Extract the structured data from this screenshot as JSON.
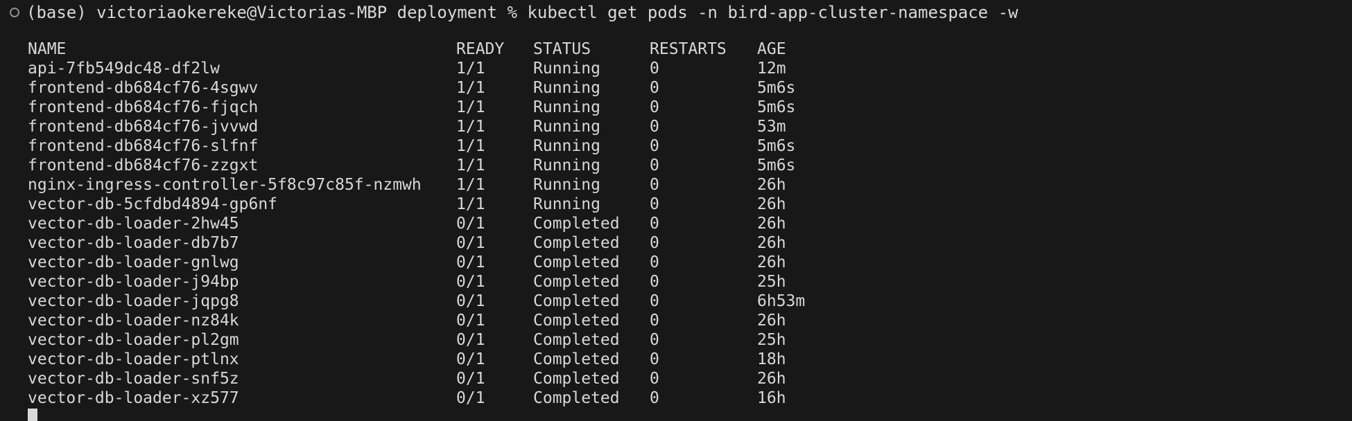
{
  "prompt": {
    "text": "(base) victoriaokereke@Victorias-MBP deployment % ",
    "command": "kubectl get pods -n bird-app-cluster-namespace -w"
  },
  "table": {
    "headers": [
      "NAME",
      "READY",
      "STATUS",
      "RESTARTS",
      "AGE"
    ],
    "rows": [
      [
        "api-7fb549dc48-df2lw",
        "1/1",
        "Running",
        "0",
        "12m"
      ],
      [
        "frontend-db684cf76-4sgwv",
        "1/1",
        "Running",
        "0",
        "5m6s"
      ],
      [
        "frontend-db684cf76-fjqch",
        "1/1",
        "Running",
        "0",
        "5m6s"
      ],
      [
        "frontend-db684cf76-jvvwd",
        "1/1",
        "Running",
        "0",
        "53m"
      ],
      [
        "frontend-db684cf76-slfnf",
        "1/1",
        "Running",
        "0",
        "5m6s"
      ],
      [
        "frontend-db684cf76-zzgxt",
        "1/1",
        "Running",
        "0",
        "5m6s"
      ],
      [
        "nginx-ingress-controller-5f8c97c85f-nzmwh",
        "1/1",
        "Running",
        "0",
        "26h"
      ],
      [
        "vector-db-5cfdbd4894-gp6nf",
        "1/1",
        "Running",
        "0",
        "26h"
      ],
      [
        "vector-db-loader-2hw45",
        "0/1",
        "Completed",
        "0",
        "26h"
      ],
      [
        "vector-db-loader-db7b7",
        "0/1",
        "Completed",
        "0",
        "26h"
      ],
      [
        "vector-db-loader-gnlwg",
        "0/1",
        "Completed",
        "0",
        "26h"
      ],
      [
        "vector-db-loader-j94bp",
        "0/1",
        "Completed",
        "0",
        "25h"
      ],
      [
        "vector-db-loader-jqpg8",
        "0/1",
        "Completed",
        "0",
        "6h53m"
      ],
      [
        "vector-db-loader-nz84k",
        "0/1",
        "Completed",
        "0",
        "26h"
      ],
      [
        "vector-db-loader-pl2gm",
        "0/1",
        "Completed",
        "0",
        "25h"
      ],
      [
        "vector-db-loader-ptlnx",
        "0/1",
        "Completed",
        "0",
        "18h"
      ],
      [
        "vector-db-loader-snf5z",
        "0/1",
        "Completed",
        "0",
        "26h"
      ],
      [
        "vector-db-loader-xz577",
        "0/1",
        "Completed",
        "0",
        "16h"
      ]
    ]
  },
  "icons": {
    "status": "circle-outline-icon"
  },
  "colors": {
    "background": "#181818",
    "text": "#d8d8d8",
    "prompt_indicator": "#8f8f8f"
  }
}
